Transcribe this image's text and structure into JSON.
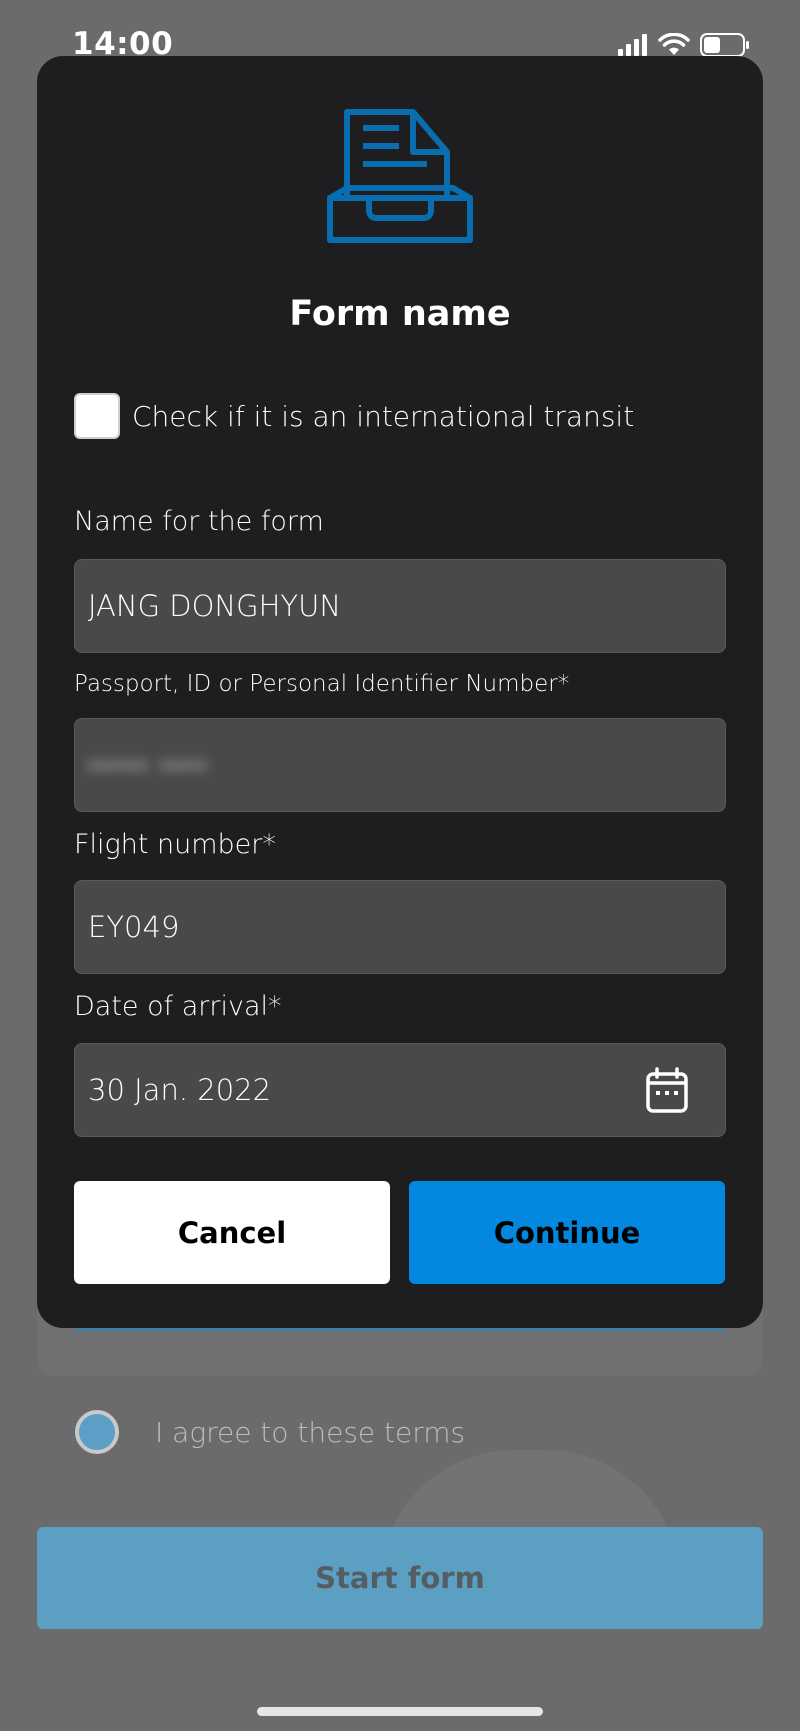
{
  "status_bar": {
    "time": "14:00",
    "icons": [
      "signal-icon",
      "wifi-icon",
      "battery-icon"
    ]
  },
  "modal": {
    "icon": "form-inbox-icon",
    "title": "Form name",
    "transit_checkbox": {
      "label": "Check if it is an international transit",
      "checked": false
    },
    "fields": {
      "name": {
        "label": "Name for the form",
        "value": "JANG DONGHYUN"
      },
      "passport": {
        "label": "Passport, ID or Personal Identifier Number*",
        "value": "••••• ••••"
      },
      "flight": {
        "label": "Flight number*",
        "value": "EY049"
      },
      "arrival": {
        "label": "Date of arrival*",
        "value": "30 Jan. 2022",
        "icon": "calendar-icon"
      }
    },
    "buttons": {
      "cancel": "Cancel",
      "continue": "Continue"
    }
  },
  "background": {
    "agree_label": "I agree to these terms",
    "start_button": "Start form"
  },
  "colors": {
    "accent": "#0289df",
    "icon_blue": "#0a6db0",
    "modal_bg": "#1e1e20",
    "field_bg": "#49494b",
    "overlay": "#6b6b6d"
  }
}
